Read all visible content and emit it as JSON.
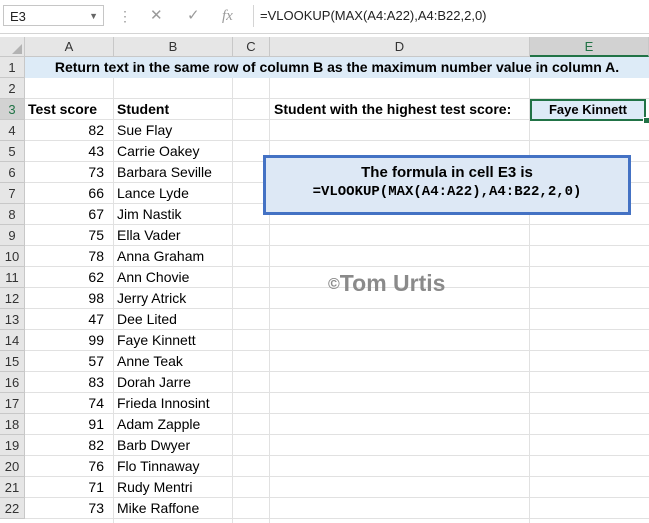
{
  "formula_bar": {
    "name_box": "E3",
    "cancel_icon": "✕",
    "confirm_icon": "✓",
    "function_icon": "fx",
    "formula": "=VLOOKUP(MAX(A4:A22),A4:B22,2,0)"
  },
  "columns": [
    "A",
    "B",
    "C",
    "D",
    "E"
  ],
  "rows": [
    "1",
    "2",
    "3",
    "4",
    "5",
    "6",
    "7",
    "8",
    "9",
    "10",
    "11",
    "12",
    "13",
    "14",
    "15",
    "16",
    "17",
    "18",
    "19",
    "20",
    "21",
    "22"
  ],
  "title": "Return text in the same row of column B as the maximum number value in column A.",
  "headers": {
    "score": "Test score",
    "student": "Student"
  },
  "label": "Student with the highest test score:",
  "result": "Faye Kinnett",
  "data": [
    {
      "score": "82",
      "student": "Sue Flay"
    },
    {
      "score": "43",
      "student": "Carrie Oakey"
    },
    {
      "score": "73",
      "student": "Barbara Seville"
    },
    {
      "score": "66",
      "student": "Lance Lyde"
    },
    {
      "score": "67",
      "student": "Jim Nastik"
    },
    {
      "score": "75",
      "student": "Ella Vader"
    },
    {
      "score": "78",
      "student": "Anna Graham"
    },
    {
      "score": "62",
      "student": "Ann Chovie"
    },
    {
      "score": "98",
      "student": "Jerry Atrick"
    },
    {
      "score": "47",
      "student": "Dee Lited"
    },
    {
      "score": "99",
      "student": "Faye Kinnett"
    },
    {
      "score": "57",
      "student": "Anne Teak"
    },
    {
      "score": "83",
      "student": "Dorah Jarre"
    },
    {
      "score": "74",
      "student": "Frieda Innosint"
    },
    {
      "score": "91",
      "student": "Adam Zapple"
    },
    {
      "score": "82",
      "student": "Barb Dwyer"
    },
    {
      "score": "76",
      "student": "Flo Tinnaway"
    },
    {
      "score": "71",
      "student": "Rudy Mentri"
    },
    {
      "score": "73",
      "student": "Mike Raffone"
    }
  ],
  "callout": {
    "line1": "The formula in cell E3 is",
    "line2": "=VLOOKUP(MAX(A4:A22),A4:B22,2,0)"
  },
  "watermark": {
    "symbol": "©",
    "text": "Tom Urtis"
  },
  "colors": {
    "accent": "#217346",
    "band": "#ddebf7",
    "callout_border": "#4472c4"
  }
}
